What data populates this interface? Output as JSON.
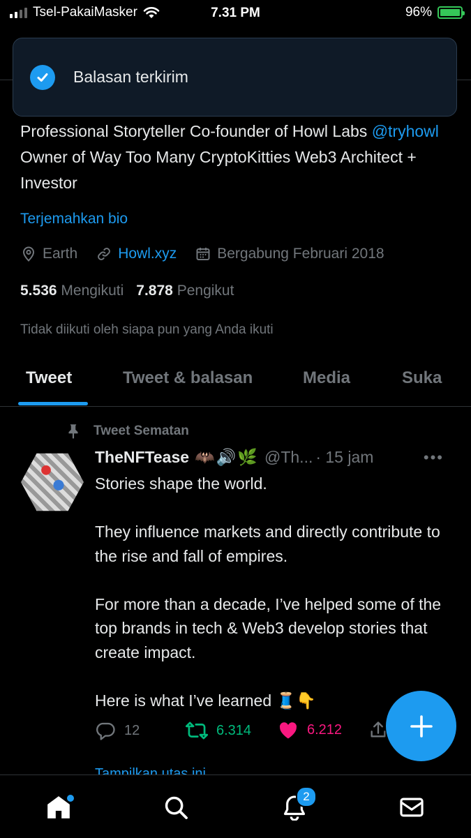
{
  "status_bar": {
    "carrier": "Tsel-PakaiMasker",
    "time": "7.31 PM",
    "battery_percent": "96%"
  },
  "toast": {
    "message": "Balasan terkirim"
  },
  "profile": {
    "bio_part1": "Professional Storyteller Co-founder of Howl Labs ",
    "bio_mention": "@tryhowl",
    "bio_part2": " Owner of Way Too Many CryptoKitties Web3 Architect + Investor",
    "translate_label": "Terjemahkan bio",
    "location": "Earth",
    "website": "Howl.xyz",
    "joined": "Bergabung Februari 2018",
    "following_count": "5.536",
    "following_label": "Mengikuti",
    "followers_count": "7.878",
    "followers_label": "Pengikut",
    "not_followed_text": "Tidak diikuti oleh siapa pun yang Anda ikuti"
  },
  "tabs": [
    {
      "label": "Tweet",
      "active": true
    },
    {
      "label": "Tweet & balasan",
      "active": false
    },
    {
      "label": "Media",
      "active": false
    },
    {
      "label": "Suka",
      "active": false
    }
  ],
  "pinned_tweet": {
    "pinned_label": "Tweet Sematan",
    "name": "TheNFTease",
    "emojis": "🦇🔊🌿",
    "handle": "@Th...",
    "time": "· 15 jam",
    "body": "Stories shape the world.\n\nThey influence markets and directly contribute to the rise and fall of empires.\n\nFor more than a decade, I’ve helped some of the top brands in tech & Web3 develop stories that create impact.\n\nHere is what I’ve learned 🧵👇",
    "replies": "12",
    "retweets": "6.314",
    "likes": "6.212",
    "show_thread": "Tampilkan utas ini"
  },
  "nav": {
    "notifications_badge": "2"
  },
  "colors": {
    "accent": "#1d9bf0",
    "retweet": "#00ba7c",
    "like": "#f91880",
    "muted": "#71767b"
  }
}
